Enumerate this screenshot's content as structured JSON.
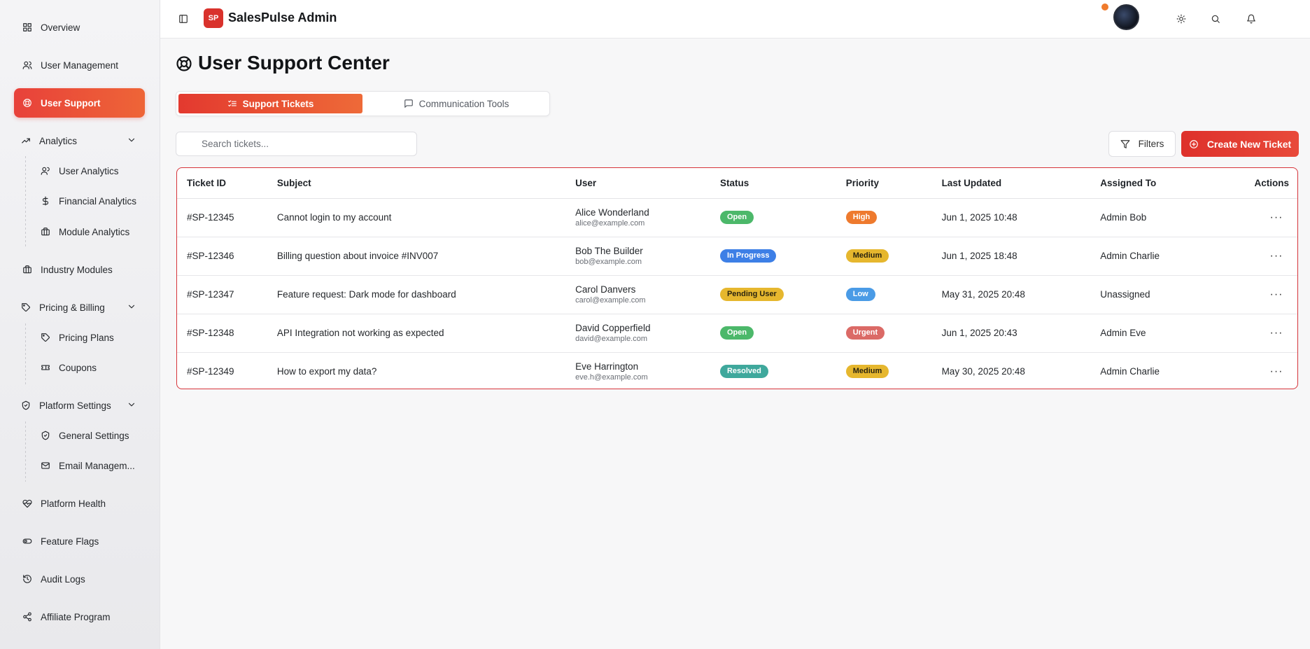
{
  "app": {
    "logo": "SP",
    "title": "SalesPulse Admin"
  },
  "sidebar": {
    "overview": "Overview",
    "user_management": "User Management",
    "user_support": "User Support",
    "analytics": "Analytics",
    "user_analytics": "User Analytics",
    "financial_analytics": "Financial Analytics",
    "module_analytics": "Module Analytics",
    "industry_modules": "Industry Modules",
    "pricing_billing": "Pricing & Billing",
    "pricing_plans": "Pricing Plans",
    "coupons": "Coupons",
    "platform_settings": "Platform Settings",
    "general_settings": "General Settings",
    "email_management": "Email Managem...",
    "platform_health": "Platform Health",
    "feature_flags": "Feature Flags",
    "audit_logs": "Audit Logs",
    "affiliate_program": "Affiliate Program"
  },
  "page": {
    "title": "User Support Center"
  },
  "tabs": {
    "support_tickets": "Support Tickets",
    "communication_tools": "Communication Tools"
  },
  "search": {
    "placeholder": "Search tickets..."
  },
  "toolbar": {
    "filters": "Filters",
    "create": "Create New Ticket"
  },
  "table": {
    "headers": {
      "id": "Ticket ID",
      "subject": "Subject",
      "user": "User",
      "status": "Status",
      "priority": "Priority",
      "updated": "Last Updated",
      "assigned": "Assigned To",
      "actions": "Actions"
    },
    "rows": [
      {
        "id": "#SP-12345",
        "subject": "Cannot login to my account",
        "user": "Alice Wonderland",
        "email": "alice@example.com",
        "status": "Open",
        "priority": "High",
        "updated": "Jun 1, 2025 10:48",
        "assigned": "Admin Bob"
      },
      {
        "id": "#SP-12346",
        "subject": "Billing question about invoice #INV007",
        "user": "Bob The Builder",
        "email": "bob@example.com",
        "status": "In Progress",
        "priority": "Medium",
        "updated": "Jun 1, 2025 18:48",
        "assigned": "Admin Charlie"
      },
      {
        "id": "#SP-12347",
        "subject": "Feature request: Dark mode for dashboard",
        "user": "Carol Danvers",
        "email": "carol@example.com",
        "status": "Pending User",
        "priority": "Low",
        "updated": "May 31, 2025 20:48",
        "assigned": "Unassigned"
      },
      {
        "id": "#SP-12348",
        "subject": "API Integration not working as expected",
        "user": "David Copperfield",
        "email": "david@example.com",
        "status": "Open",
        "priority": "Urgent",
        "updated": "Jun 1, 2025 20:43",
        "assigned": "Admin Eve"
      },
      {
        "id": "#SP-12349",
        "subject": "How to export my data?",
        "user": "Eve Harrington",
        "email": "eve.h@example.com",
        "status": "Resolved",
        "priority": "Medium",
        "updated": "May 30, 2025 20:48",
        "assigned": "Admin Charlie"
      }
    ]
  },
  "colors": {
    "accent": "#e3392f",
    "status_open": "#4cb86a",
    "status_in_progress": "#3d7fe6",
    "status_pending_user": "#e6b72e",
    "status_resolved": "#3fa89c",
    "priority_high": "#ee7a2e",
    "priority_medium": "#e6b72e",
    "priority_low": "#4a9be6",
    "priority_urgent": "#db6a66",
    "notification_dot": "#f07b2d"
  }
}
